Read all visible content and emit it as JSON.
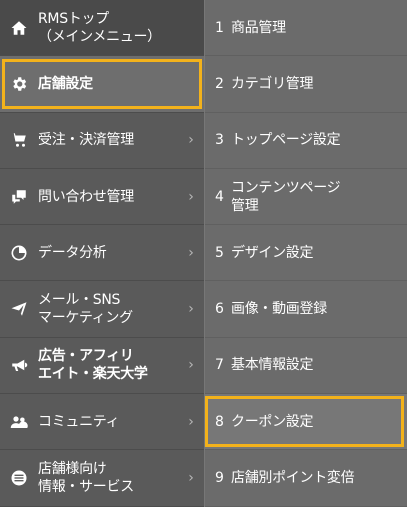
{
  "sidebar": {
    "items": [
      {
        "label": "RMSトップ\n（メインメニュー）",
        "icon": "home-icon"
      },
      {
        "label": "店舗設定",
        "icon": "gear-icon"
      },
      {
        "label": "受注・決済管理",
        "icon": "cart-icon"
      },
      {
        "label": "問い合わせ管理",
        "icon": "chat-icon"
      },
      {
        "label": "データ分析",
        "icon": "pie-chart-icon"
      },
      {
        "label": "メール・SNS\nマーケティング",
        "icon": "paper-plane-icon"
      },
      {
        "label": "広告・アフィリ\nエイト・楽天大学",
        "icon": "megaphone-icon"
      },
      {
        "label": "コミュニティ",
        "icon": "users-icon"
      },
      {
        "label": "店舗様向け\n情報・サービス",
        "icon": "list-icon"
      }
    ],
    "chevron": "›"
  },
  "submenu": {
    "items": [
      {
        "num": "1",
        "label": "商品管理"
      },
      {
        "num": "2",
        "label": "カテゴリ管理"
      },
      {
        "num": "3",
        "label": "トップページ設定"
      },
      {
        "num": "4",
        "label": "コンテンツページ\n管理"
      },
      {
        "num": "5",
        "label": "デザイン設定"
      },
      {
        "num": "6",
        "label": "画像・動画登録"
      },
      {
        "num": "7",
        "label": "基本情報設定"
      },
      {
        "num": "8",
        "label": "クーポン設定"
      },
      {
        "num": "9",
        "label": "店舗別ポイント変倍"
      }
    ]
  },
  "colors": {
    "highlight": "#f3b21b",
    "sidebar_bg": "#5a5a5a",
    "submenu_bg": "#6b6b6b"
  }
}
